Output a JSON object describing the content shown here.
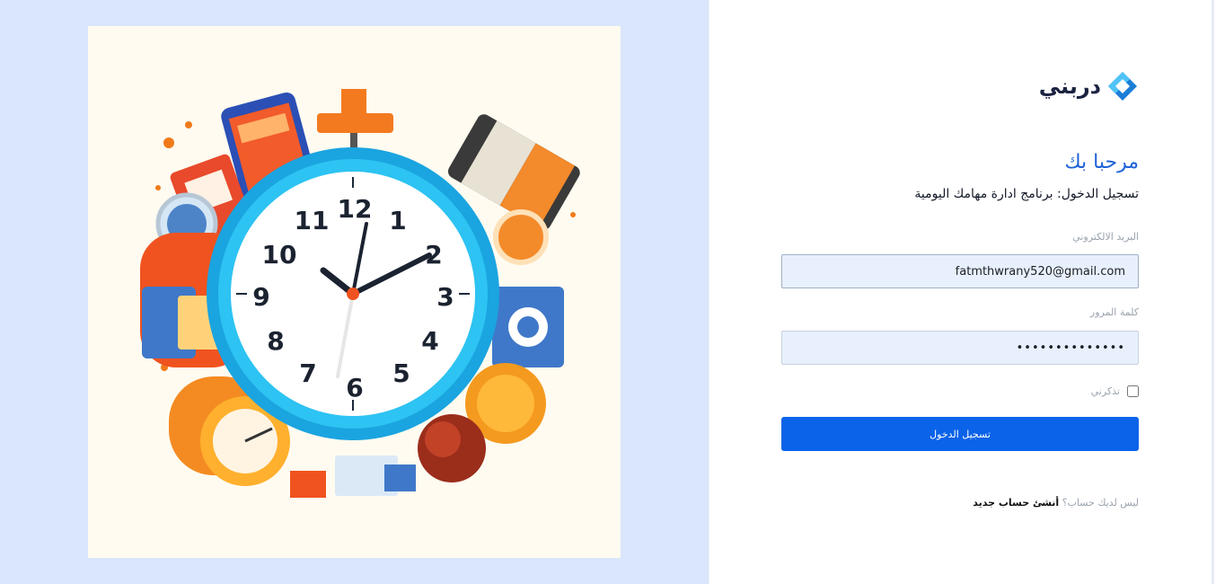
{
  "brand": {
    "name": "دربني"
  },
  "form": {
    "welcome": "مرحبا بك",
    "subtitle": "تسجيل الدخول: برنامج ادارة مهامك اليومية",
    "email_label": "البريد الالكتروني",
    "email_value": "fatmthwrany520@gmail.com",
    "password_label": "كلمة المرور",
    "password_value": "••••••••••••••",
    "remember_label": "تذكرني",
    "remember_checked": false,
    "submit_label": "تسجيل الدخول",
    "signup_prompt": "ليس لديك حساب؟",
    "signup_link": "أنشئ حساب جديد"
  },
  "illustration": {
    "icon": "clock-illustration"
  },
  "colors": {
    "left_bg": "#d9e6fb",
    "accent": "#0a63e8",
    "welcome": "#1f63d8",
    "input_bg": "#e8f0fe"
  }
}
